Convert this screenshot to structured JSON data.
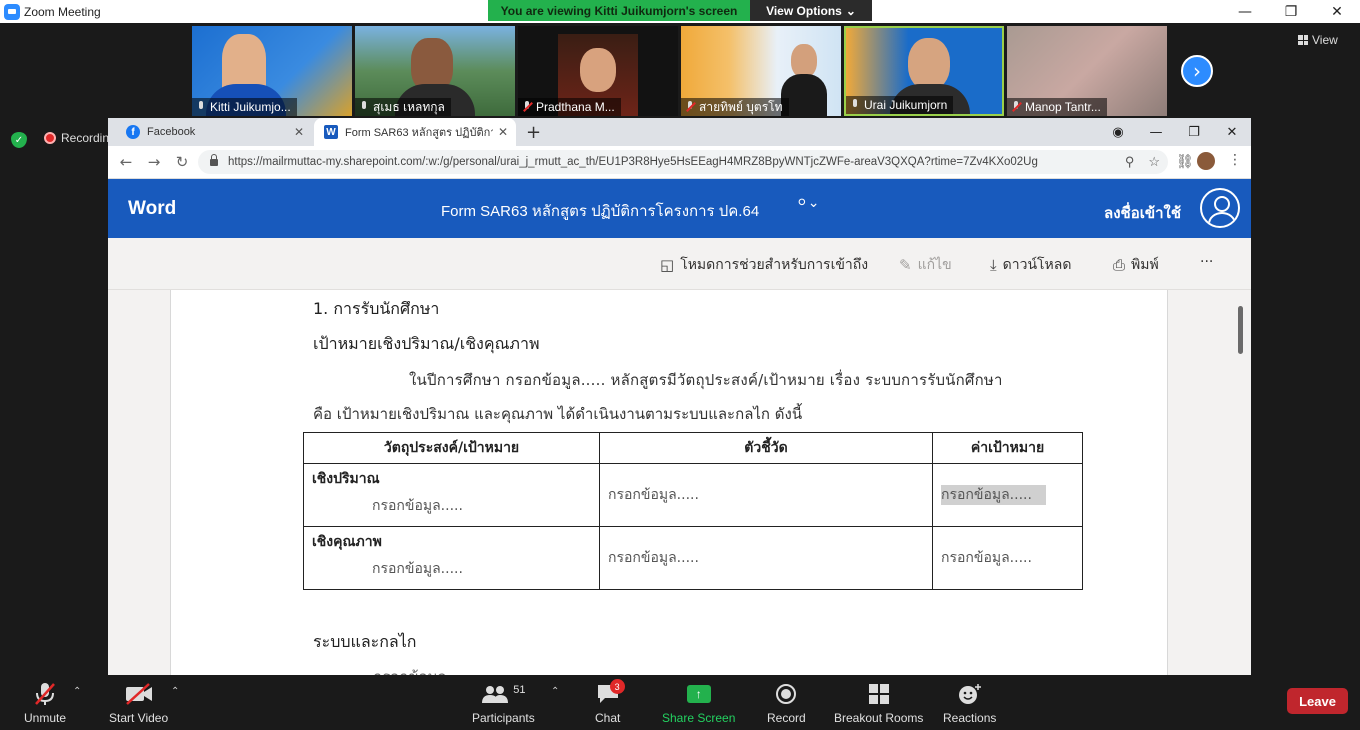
{
  "app": {
    "title": "Zoom Meeting",
    "viewing_banner": "You are viewing Kitti Juikumjorn's screen",
    "view_options": "View Options",
    "view_label": "View",
    "recording_label": "Recording",
    "next_arrow": "›"
  },
  "participants": [
    {
      "name": "Kitti Juikumjo...",
      "muted": false
    },
    {
      "name": "สุเมธ เหลทกุล",
      "muted": false
    },
    {
      "name": "Pradthana M...",
      "muted": true
    },
    {
      "name": "สายทิพย์ บุตรโท",
      "muted": true
    },
    {
      "name": "Urai Juikumjorn",
      "muted": false
    },
    {
      "name": "Manop Tantr...",
      "muted": true
    }
  ],
  "browser": {
    "tabs": [
      {
        "label": "Facebook",
        "active": false
      },
      {
        "label": "Form SAR63 หลักสูตร ปฏิบัติการโครง...",
        "active": true
      }
    ],
    "url": "https://mailrmuttac-my.sharepoint.com/:w:/g/personal/urai_j_rmutt_ac_th/EU1P3R8Hye5HsEEagH4MRZ8BpyWNTjcZWFe-areaV3QXQA?rtime=7Zv4KXo02Ug"
  },
  "word": {
    "brand": "Word",
    "doc_title": "Form SAR63 หลักสูตร ปฏิบัติการโครงการ ปค.64",
    "signin": "ลงชื่อเข้าใช้",
    "commands": {
      "accessibility": "โหมดการช่วยสำหรับการเข้าถึง",
      "edit": "แก้ไข",
      "download": "ดาวน์โหลด",
      "print": "พิมพ์",
      "more": "···"
    }
  },
  "document": {
    "heading1": "1. การรับนักศึกษา",
    "heading2": "เป้าหมายเชิงปริมาณ/เชิงคุณภาพ",
    "para1": "ในปีการศึกษา กรอกข้อมูล..... หลักสูตรมีวัตถุประสงค์/เป้าหมาย เรื่อง ระบบการรับนักศึกษา",
    "para2": "คือ เป้าหมายเชิงปริมาณ และคุณภาพ ได้ดำเนินงานตามระบบและกลไก ดังนี้",
    "table": {
      "headers": [
        "วัตถุประสงค์/เป้าหมาย",
        "ตัวชี้วัด",
        "ค่าเป้าหมาย"
      ],
      "rows": [
        {
          "label": "เชิงปริมาณ",
          "sub": "กรอกข้อมูล.....",
          "indicator": "กรอกข้อมูล.....",
          "target": "กรอกข้อมูล....."
        },
        {
          "label": "เชิงคุณภาพ",
          "sub": "กรอกข้อมูล.....",
          "indicator": "กรอกข้อมูล.....",
          "target": "กรอกข้อมูล....."
        }
      ]
    },
    "heading3": "ระบบและกลไก",
    "cut_text": "กรอกข้อมูล"
  },
  "controls": {
    "unmute": "Unmute",
    "start_video": "Start Video",
    "participants": "Participants",
    "participant_count": "51",
    "chat": "Chat",
    "chat_badge": "3",
    "share_screen": "Share Screen",
    "record": "Record",
    "breakout_rooms": "Breakout Rooms",
    "reactions": "Reactions",
    "leave": "Leave"
  },
  "colors": {
    "zoom_green": "#23b14d",
    "word_blue": "#185abd",
    "leave_red": "#c0262d",
    "zoom_blue": "#2d8cff"
  }
}
